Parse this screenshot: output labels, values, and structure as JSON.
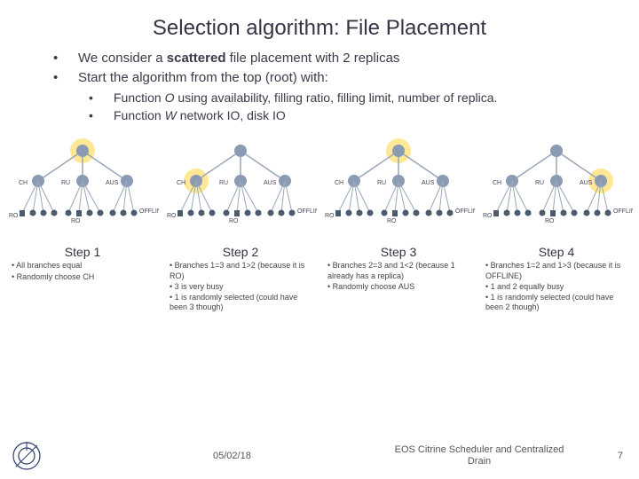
{
  "title": "Selection algorithm: File Placement",
  "bullets": {
    "b1a_pre": "We consider a ",
    "b1a_bold": "scattered",
    "b1a_post": " file placement with 2 replicas",
    "b1b": "Start the algorithm from the top (root) with:",
    "s1_pre": "Function ",
    "s1_i": "O",
    "s1_post": " using availability, filling ratio, filling limit, number of replica.",
    "s2_pre": "Function ",
    "s2_i": "W",
    "s2_post": " network IO, disk IO"
  },
  "branches": {
    "l1": "CH",
    "l2": "RU",
    "l3": "AUS"
  },
  "leaf": {
    "ro1": "RO",
    "ro2": "RO",
    "off": "OFFLINE"
  },
  "steps": {
    "s1": {
      "label": "Step 1",
      "n1": "• All branches equal",
      "n2": "• Randomly choose CH"
    },
    "s2": {
      "label": "Step 2",
      "n1": "• Branches 1=3 and 1>2 (because it is RO)",
      "n2": "• 3 is very busy",
      "n3": "• 1 is randomly selected (could have been 3 though)"
    },
    "s3": {
      "label": "Step 3",
      "n1": "• Branches 2=3 and 1<2 (because 1 already has a replica)",
      "n2": "• Randomly choose AUS"
    },
    "s4": {
      "label": "Step 4",
      "n1": "• Branches 1=2 and 1>3 (because it is OFFLINE)",
      "n2": "• 1 and 2 equally busy",
      "n3": "• 1 is randomly selected (could have been 2 though)"
    }
  },
  "footer": {
    "date": "05/02/18",
    "conf": "EOS Citrine Scheduler and Centralized Drain",
    "page": "7"
  },
  "colors": {
    "highlight": "#ffe58a",
    "node": "#8b9bb3",
    "line": "#9aa6b8",
    "leafnode": "#4c5a6d"
  }
}
